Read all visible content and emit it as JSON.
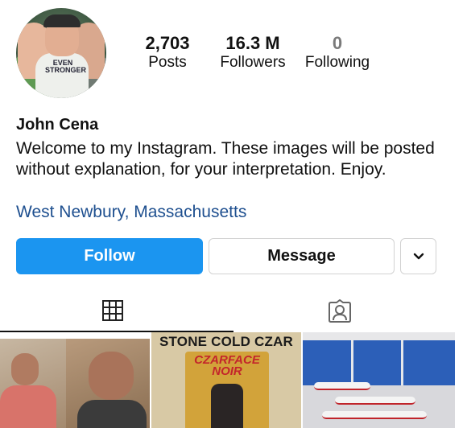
{
  "profile": {
    "name": "John Cena",
    "bio": "Welcome to my Instagram. These images will be posted without explanation, for your interpretation. Enjoy.",
    "location": "West Newbury, Massachusetts",
    "avatar_text": "EVEN STRONGER"
  },
  "stats": {
    "posts": {
      "value": "2,703",
      "label": "Posts"
    },
    "followers": {
      "value": "16.3 M",
      "label": "Followers"
    },
    "following": {
      "value": "0",
      "label": "Following"
    }
  },
  "actions": {
    "follow_label": "Follow",
    "message_label": "Message",
    "more_icon": "chevron-down-icon"
  },
  "tabs": [
    {
      "icon": "grid-icon",
      "selected": true
    },
    {
      "icon": "tagged-person-icon",
      "selected": false
    }
  ],
  "grid": {
    "tiles": [
      {
        "description_icon": "photo"
      },
      {
        "title": "STONE COLD CZAR NOIR",
        "logo": "CZARFACE",
        "sub": "NOIR"
      },
      {
        "description_icon": "photo"
      }
    ]
  },
  "colors": {
    "follow_button": "#1b95f0",
    "location_link": "#1e4f8f"
  }
}
